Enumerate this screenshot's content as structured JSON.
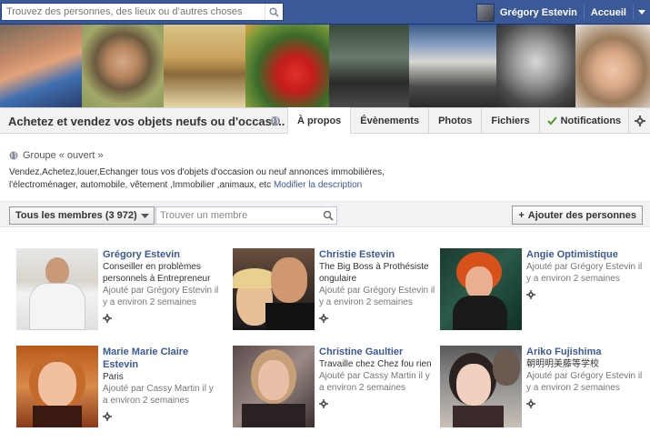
{
  "topbar": {
    "search_placeholder": "Trouvez des personnes, des lieux ou d’autres choses",
    "user_name": "Grégory Estevin",
    "home_label": "Accueil"
  },
  "group": {
    "title": "Achetez et vendez vos objets neufs ou d'occasi...",
    "tabs": [
      {
        "label": "À propos",
        "active": true
      },
      {
        "label": "Évènements"
      },
      {
        "label": "Photos"
      },
      {
        "label": "Fichiers"
      },
      {
        "label": "Notifications"
      }
    ],
    "type_label": "Groupe « ouvert »",
    "description": "Vendez,Achetez,louer,Echanger tous vos d'objets d'occasion ou neuf annonces immobilières, l'électroménager, automobile, vêtement ,Immobilier ,animaux, etc",
    "edit_link": "Modifier la description"
  },
  "filter": {
    "members_label": "Tous les membres (3 972)",
    "find_placeholder": "Trouver un membre",
    "add_label": "Ajouter des personnes"
  },
  "members": [
    {
      "name": "Grégory Estevin",
      "lines": [
        "Conseiller en problèmes personnels à Entrepreneur"
      ],
      "meta": "Ajouté par Grégory Estevin il y a environ 2 semaines"
    },
    {
      "name": "Christie Estevin",
      "lines": [
        "The Big Boss à Prothésiste ongulaire"
      ],
      "meta": "Ajouté par Grégory Estevin il y a environ 2 semaines"
    },
    {
      "name": "Angie Optimistique",
      "lines": [],
      "meta": "Ajouté par Grégory Estevin il y a environ 2 semaines"
    },
    {
      "name": "Marie Marie Claire Estevin",
      "lines": [
        "Paris"
      ],
      "meta": "Ajouté par Cassy Martin il y a environ 2 semaines"
    },
    {
      "name": "Christine Gaultier",
      "lines": [
        "Travaille chez Chez fou rien"
      ],
      "meta": "Ajouté par Cassy Martin il y a environ 2 semaines"
    },
    {
      "name": "Ariko Fujishima",
      "lines": [
        "朝明明美藤等学校"
      ],
      "meta": "Ajouté par Grégory Estevin il y a environ 2 semaines"
    }
  ],
  "colors": {
    "brand": "#3b5998",
    "link": "#3b5998",
    "check": "#4c9a2a"
  }
}
